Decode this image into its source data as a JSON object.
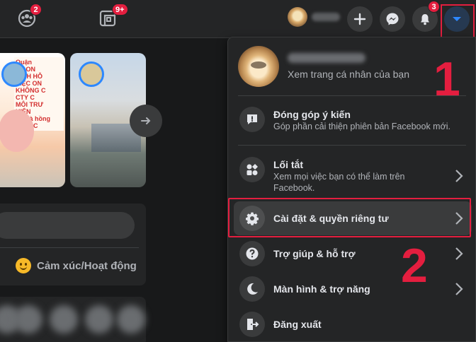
{
  "topbar": {
    "groups_badge": "2",
    "gaming_badge": "9+",
    "notifications_badge": "3"
  },
  "feed": {
    "story_text_lines": [
      "Quận",
      "PV ON",
      "DỊCH HỖ",
      "VIỆC ON",
      "KHÔNG C",
      "CTY C",
      "MÔI TRƯ",
      "HIỆN",
      "Di mà hồng",
      "GIẢN C"
    ],
    "feeling_label": "Cảm xúc/Hoạt động"
  },
  "menu": {
    "profile_sub": "Xem trang cá nhân của bạn",
    "items": [
      {
        "title": "Đóng góp ý kiến",
        "sub": "Góp phần cải thiện phiên bản Facebook mới.",
        "icon": "feedback-icon"
      },
      {
        "title": "Lối tắt",
        "sub": "Xem mọi việc bạn có thể làm trên Facebook.",
        "icon": "shortcuts-icon"
      },
      {
        "title": "Cài đặt & quyền riêng tư",
        "sub": "",
        "icon": "gear-icon"
      },
      {
        "title": "Trợ giúp & hỗ trợ",
        "sub": "",
        "icon": "help-icon"
      },
      {
        "title": "Màn hình & trợ năng",
        "sub": "",
        "icon": "moon-icon"
      },
      {
        "title": "Đăng xuất",
        "sub": "",
        "icon": "logout-icon"
      }
    ]
  },
  "annotations": {
    "step1": "1",
    "step2": "2"
  },
  "colors": {
    "accent": "#2d88ff",
    "highlight": "#e41e3f",
    "panel": "#242526"
  }
}
